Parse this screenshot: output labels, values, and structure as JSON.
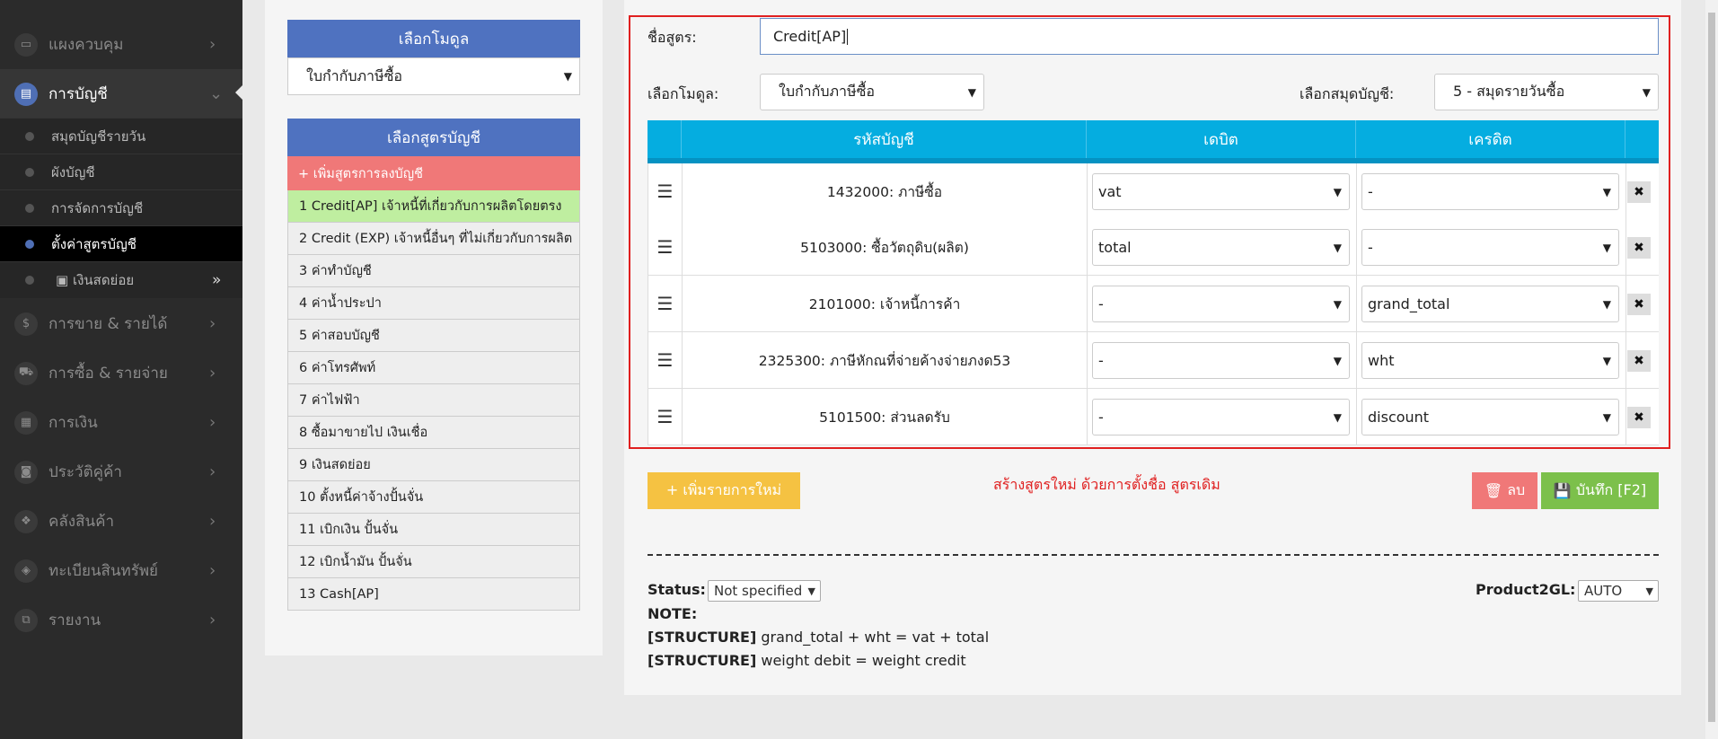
{
  "sidebar": {
    "items": [
      {
        "icon": "monitor-icon",
        "glyph": "▭",
        "label": "แผงควบคุม"
      },
      {
        "icon": "book-icon",
        "glyph": "▤",
        "label": "การบัญชี"
      },
      {
        "icon": "dollar-icon",
        "glyph": "$",
        "label": "การขาย & รายได้"
      },
      {
        "icon": "cart-icon",
        "glyph": "⛟",
        "label": "การซื้อ & รายจ่าย"
      },
      {
        "icon": "calendar-icon",
        "glyph": "▦",
        "label": "การเงิน"
      },
      {
        "icon": "contact-book-icon",
        "glyph": "◙",
        "label": "ประวัติคู่ค้า"
      },
      {
        "icon": "cubes-icon",
        "glyph": "❖",
        "label": "คลังสินค้า"
      },
      {
        "icon": "diamond-icon",
        "glyph": "◈",
        "label": "ทะเบียนสินทรัพย์"
      },
      {
        "icon": "copy-icon",
        "glyph": "⧉",
        "label": "รายงาน"
      }
    ],
    "subitems": [
      {
        "label": "สมุดบัญชีรายวัน"
      },
      {
        "label": "ผังบัญชี"
      },
      {
        "label": "การจัดการบัญชี"
      },
      {
        "label": "ตั้งค่าสูตรบัญชี"
      },
      {
        "label": "เงินสดย่อย"
      }
    ]
  },
  "left": {
    "module_header": "เลือกโมดูล",
    "module_value": "ใบกำกับภาษีซื้อ",
    "formula_header": "เลือกสูตรบัญชี",
    "add_formula": "+ เพิ่มสูตรการลงบัญชี",
    "formulas": [
      "1 Credit[AP] เจ้าหนี้ที่เกี่ยวกับการผลิตโดยตรง",
      "2 Credit (EXP) เจ้าหนี้อื่นๆ ที่ไม่เกี่ยวกับการผลิต",
      "3 ค่าทำบัญชี",
      "4 ค่าน้ำประปา",
      "5 ค่าสอบบัญชี",
      "6 ค่าโทรศัพท์",
      "7 ค่าไฟฟ้า",
      "8 ซื้อมาขายไป เงินเชื่อ",
      "9 เงินสดย่อย",
      "10 ตั้งหนี้ค่าจ้างปั้นจั่น",
      "11 เบิกเงิน ปั้นจั่น",
      "12 เบิกน้ำมัน ปั้นจั่น",
      "13 Cash[AP]"
    ]
  },
  "form": {
    "name_label": "ชื่อสูตร:",
    "name_value": "Credit[AP]",
    "module_label": "เลือกโมดูล:",
    "module_value": "ใบกำกับภาษีซื้อ",
    "journal_label": "เลือกสมุดบัญชี:",
    "journal_value": "5 - สมุดรายวันซื้อ",
    "columns": {
      "account": "รหัสบัญชี",
      "debit": "เดบิต",
      "credit": "เครดิต"
    },
    "rows": [
      {
        "account": "1432000: ภาษีซื้อ",
        "debit": "vat",
        "credit": "-"
      },
      {
        "account": "5103000: ซื้อวัตถุดิบ(ผลิต)",
        "debit": "total",
        "credit": "-"
      },
      {
        "account": "2101000: เจ้าหนี้การค้า",
        "debit": "-",
        "credit": "grand_total"
      },
      {
        "account": "2325300: ภาษีหักณที่จ่ายค้างจ่ายภงด53",
        "debit": "-",
        "credit": "wht"
      },
      {
        "account": "5101500: ส่วนลดรับ",
        "debit": "-",
        "credit": "discount"
      }
    ],
    "add_row": "+ เพิ่มรายการใหม่",
    "hint": "สร้างสูตรใหม่ ด้วยการตั้งชื่อ สูตรเดิม",
    "delete": "ลบ",
    "save": "บันทึก [F2]"
  },
  "footer": {
    "status_label": "Status:",
    "status_value": "Not specified",
    "product_label": "Product2GL:",
    "product_value": "AUTO",
    "note_label": "NOTE:",
    "structure_tag": "[STRUCTURE]",
    "structure_1": " grand_total + wht = vat + total",
    "structure_2": " weight debit = weight credit"
  },
  "colors": {
    "accent": "#4f72c0",
    "table_header": "#05ade0",
    "danger": "#f07878",
    "selected": "#bfeea0",
    "warning": "#f5c242",
    "success": "#7cc04b"
  }
}
